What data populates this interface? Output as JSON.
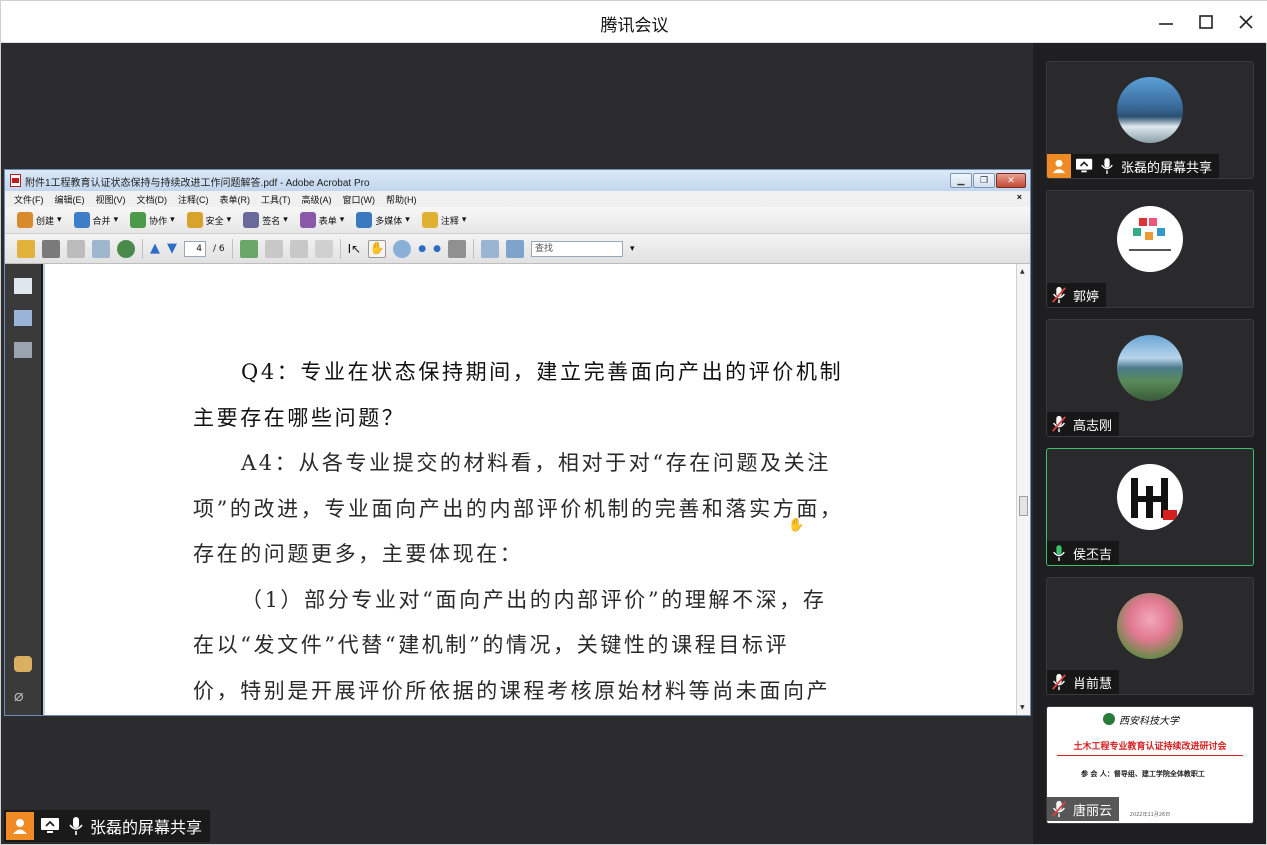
{
  "window": {
    "title": "腾讯会议",
    "controls": [
      "—",
      "☐",
      "✕"
    ]
  },
  "acrobat": {
    "title": "附件1工程教育认证状态保持与持续改进工作问题解答.pdf - Adobe Acrobat Pro",
    "menus": [
      "文件(F)",
      "编辑(E)",
      "视图(V)",
      "文档(D)",
      "注释(C)",
      "表单(R)",
      "工具(T)",
      "高级(A)",
      "窗口(W)",
      "帮助(H)"
    ],
    "menu_close": "×",
    "toolbar": [
      {
        "label": "创建",
        "color": "#d98a2b"
      },
      {
        "label": "合并",
        "color": "#3e7ec8"
      },
      {
        "label": "协作",
        "color": "#4a9a4a"
      },
      {
        "label": "安全",
        "color": "#d7a32a"
      },
      {
        "label": "签名",
        "color": "#6a6a9a"
      },
      {
        "label": "表单",
        "color": "#8a5aa8"
      },
      {
        "label": "多媒体",
        "color": "#3a78c0"
      },
      {
        "label": "注释",
        "color": "#e0b030"
      }
    ],
    "page_current": "4",
    "page_total": "/ 6",
    "find_placeholder": "查找",
    "document_lines": [
      "Q4：专业在状态保持期间，建立完善面向产出的评价机制",
      "主要存在哪些问题？",
      "A4：从各专业提交的材料看，相对于对“存在问题及关注",
      "项”的改进，专业面向产出的内部评价机制的完善和落实方面，",
      "存在的问题更多，主要体现在：",
      "（1）部分专业对“面向产出的内部评价”的理解不深，存",
      "在以“发文件”代替“建机制”的情况，关键性的课程目标评",
      "价，特别是开展评价所依据的课程考核原始材料等尚未面向产"
    ]
  },
  "sharer": {
    "label": "张磊的屏幕共享"
  },
  "participants": [
    {
      "name": "张磊的屏幕共享",
      "muted": false,
      "sharing": true,
      "active": false,
      "avatar": "lake-birds"
    },
    {
      "name": "郭婷",
      "muted": true,
      "sharing": false,
      "active": false,
      "avatar": "logo"
    },
    {
      "name": "高志刚",
      "muted": true,
      "sharing": false,
      "active": false,
      "avatar": "lake-mountain"
    },
    {
      "name": "侯丕吉",
      "muted": false,
      "sharing": false,
      "active": true,
      "avatar": "letters"
    },
    {
      "name": "肖前慧",
      "muted": true,
      "sharing": false,
      "active": false,
      "avatar": "tulips"
    },
    {
      "name": "唐丽云",
      "muted": true,
      "sharing": false,
      "active": false,
      "avatar": "slide"
    }
  ],
  "slide": {
    "university": "西安科技大学",
    "title": "土木工程专业教育认证持续改进研讨会",
    "attendees": "参 会 人：督导组、建工学院全体教职工",
    "date": "2022年11月26日"
  },
  "colors": {
    "accent_orange": "#f08a24",
    "active_green": "#3ac26a",
    "mute_red": "#e04040",
    "slide_red": "#d62020"
  }
}
